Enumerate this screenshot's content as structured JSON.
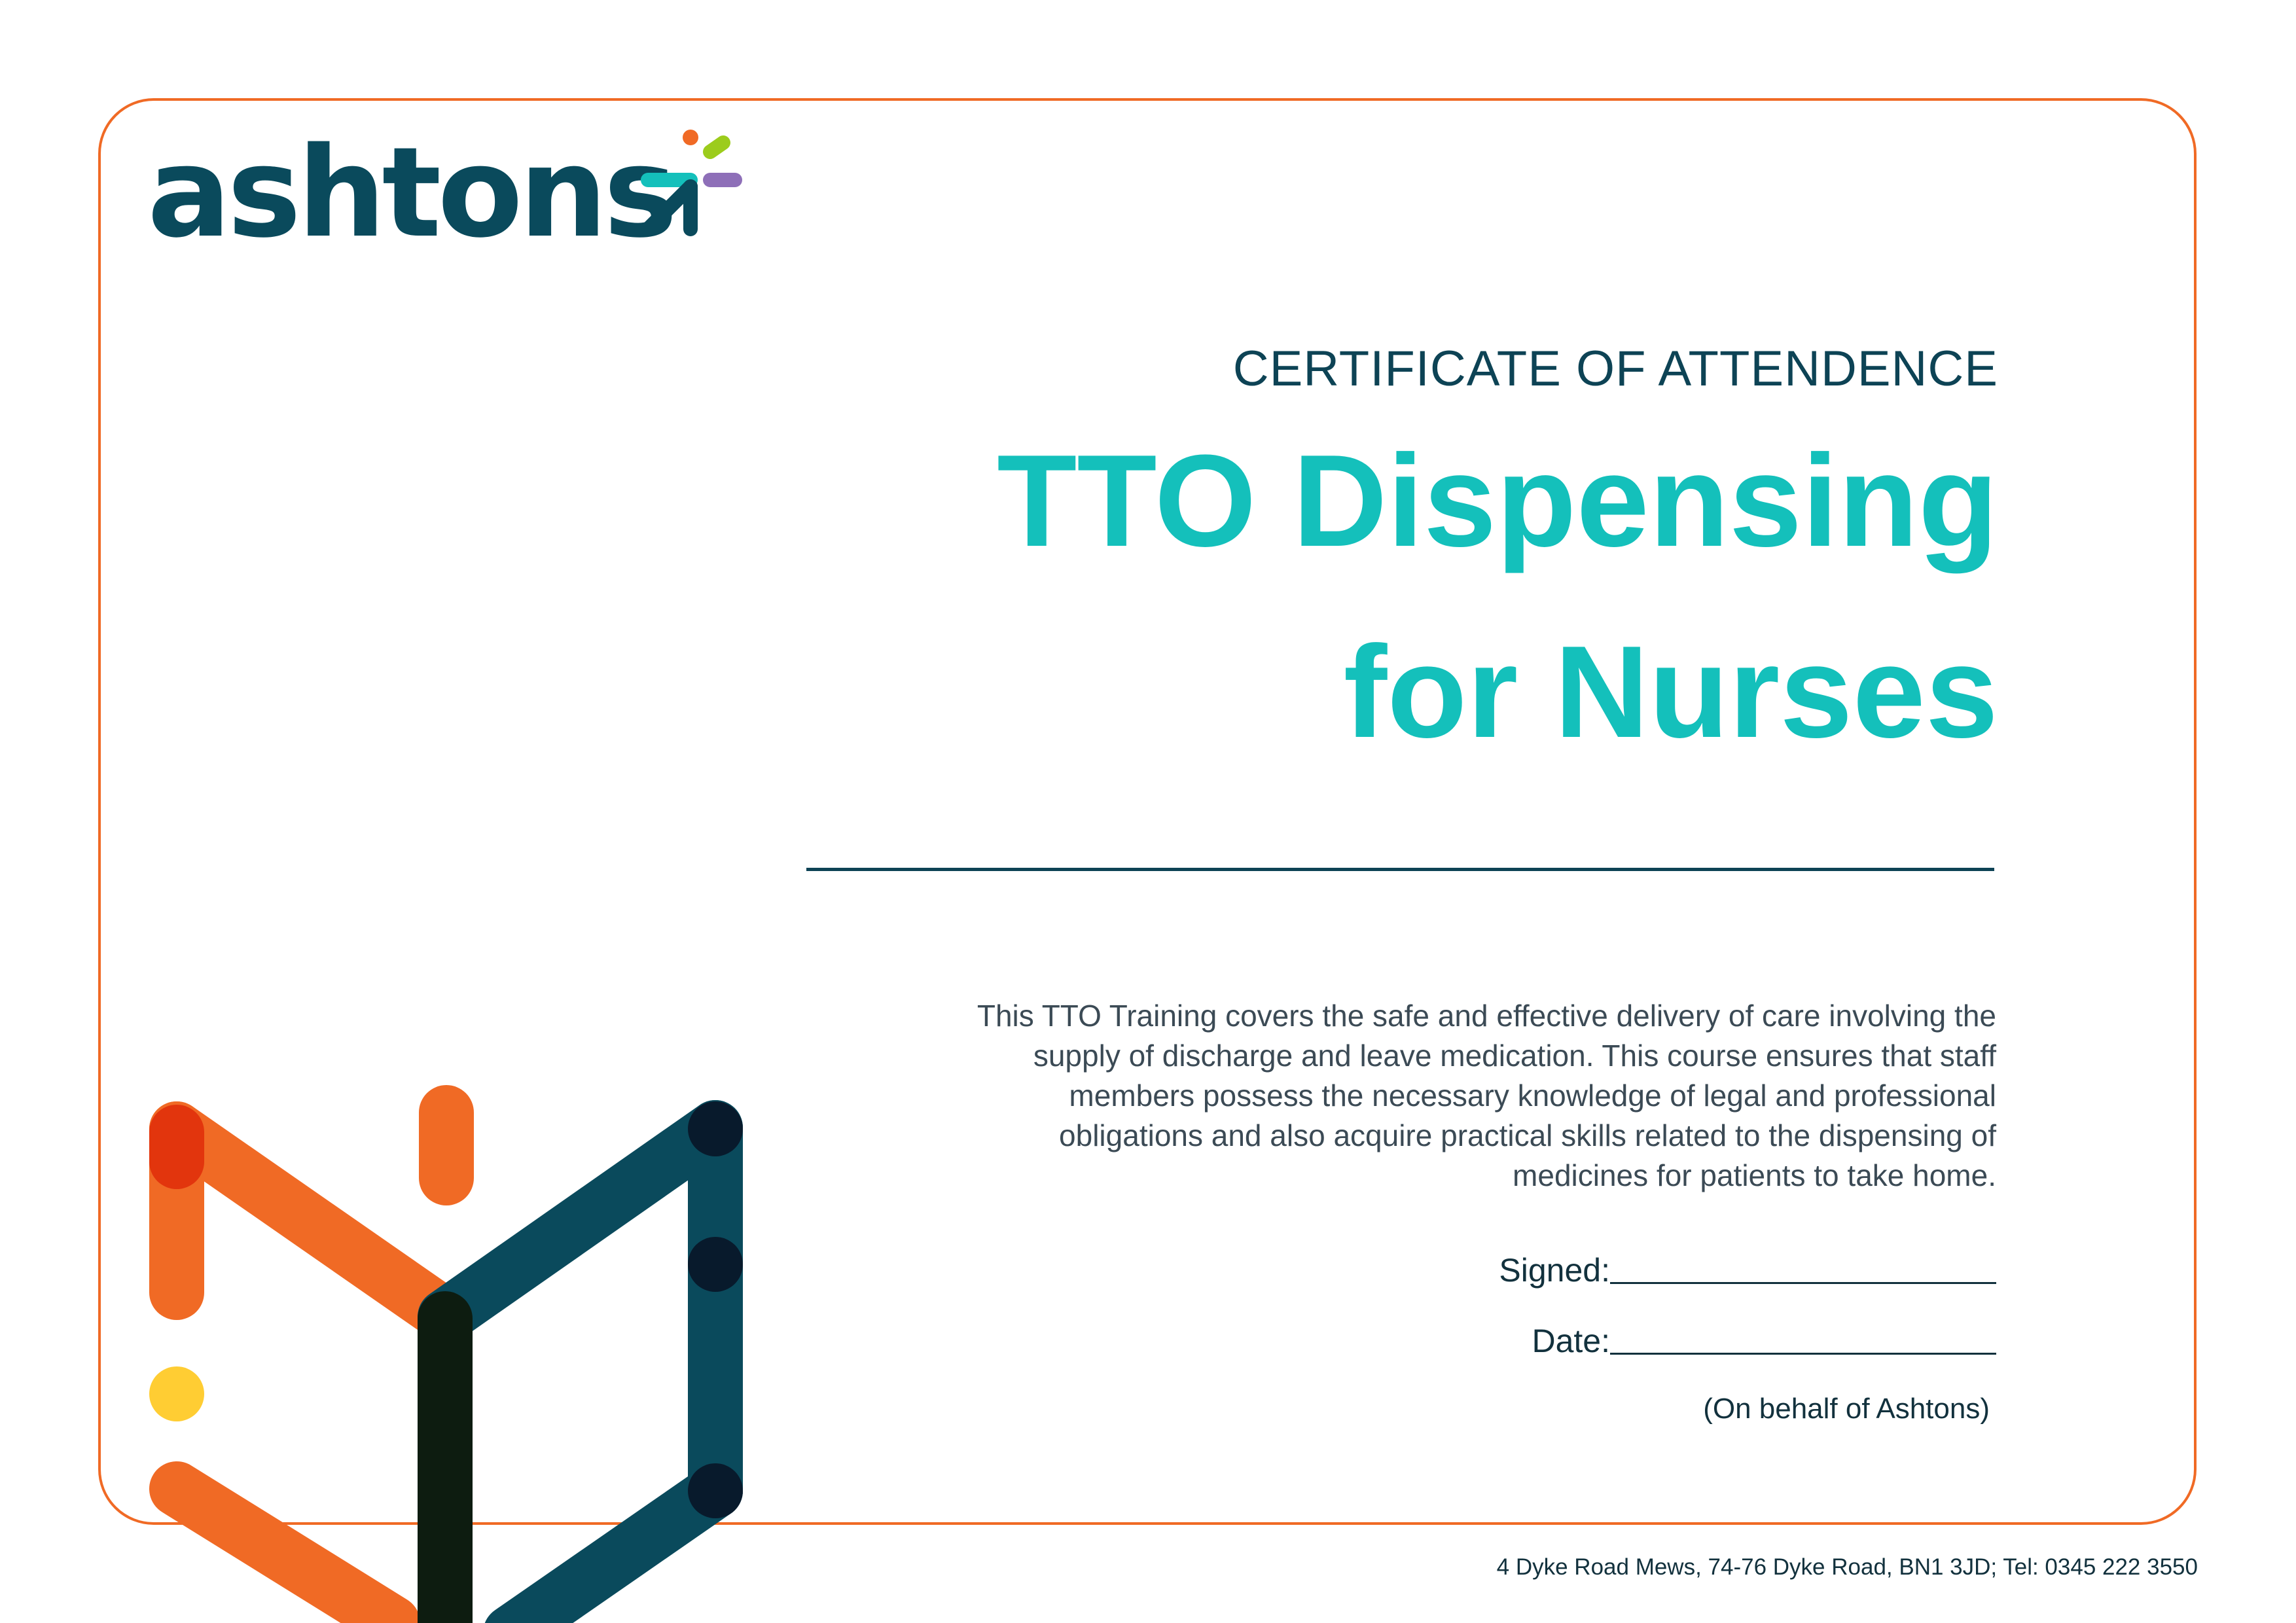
{
  "brand": {
    "name": "ashtons"
  },
  "certificate": {
    "subtitle": "CERTIFICATE OF ATTENDENCE",
    "title_line_1": "TTO Dispensing",
    "title_line_2": "for Nurses",
    "description": "This TTO Training covers the safe and effective delivery of care involving the supply of discharge and leave medication. This course ensures that staff members possess the necessary knowledge of legal and professional obligations and also acquire practical skills related to the dispensing of medicines for patients to take home."
  },
  "signature": {
    "signed_label": "Signed:",
    "date_label": "Date:",
    "behalf_text": "(On behalf of Ashtons)"
  },
  "footer": {
    "address": "4 Dyke Road Mews, 74-76 Dyke Road, BN1 3JD; Tel: 0345 222 3550"
  },
  "colors": {
    "border": "#f06a25",
    "navy": "#0a4a5c",
    "teal": "#14c0bb",
    "orange": "#f06a25",
    "red": "#e2350d",
    "yellow": "#ffcd33",
    "lime": "#9ccc1c",
    "purple": "#8e6fb8",
    "dark": "#0d1c10"
  },
  "icons": [
    "ashtons-logo-mark-icon",
    "decorative-shapes-graphic"
  ]
}
